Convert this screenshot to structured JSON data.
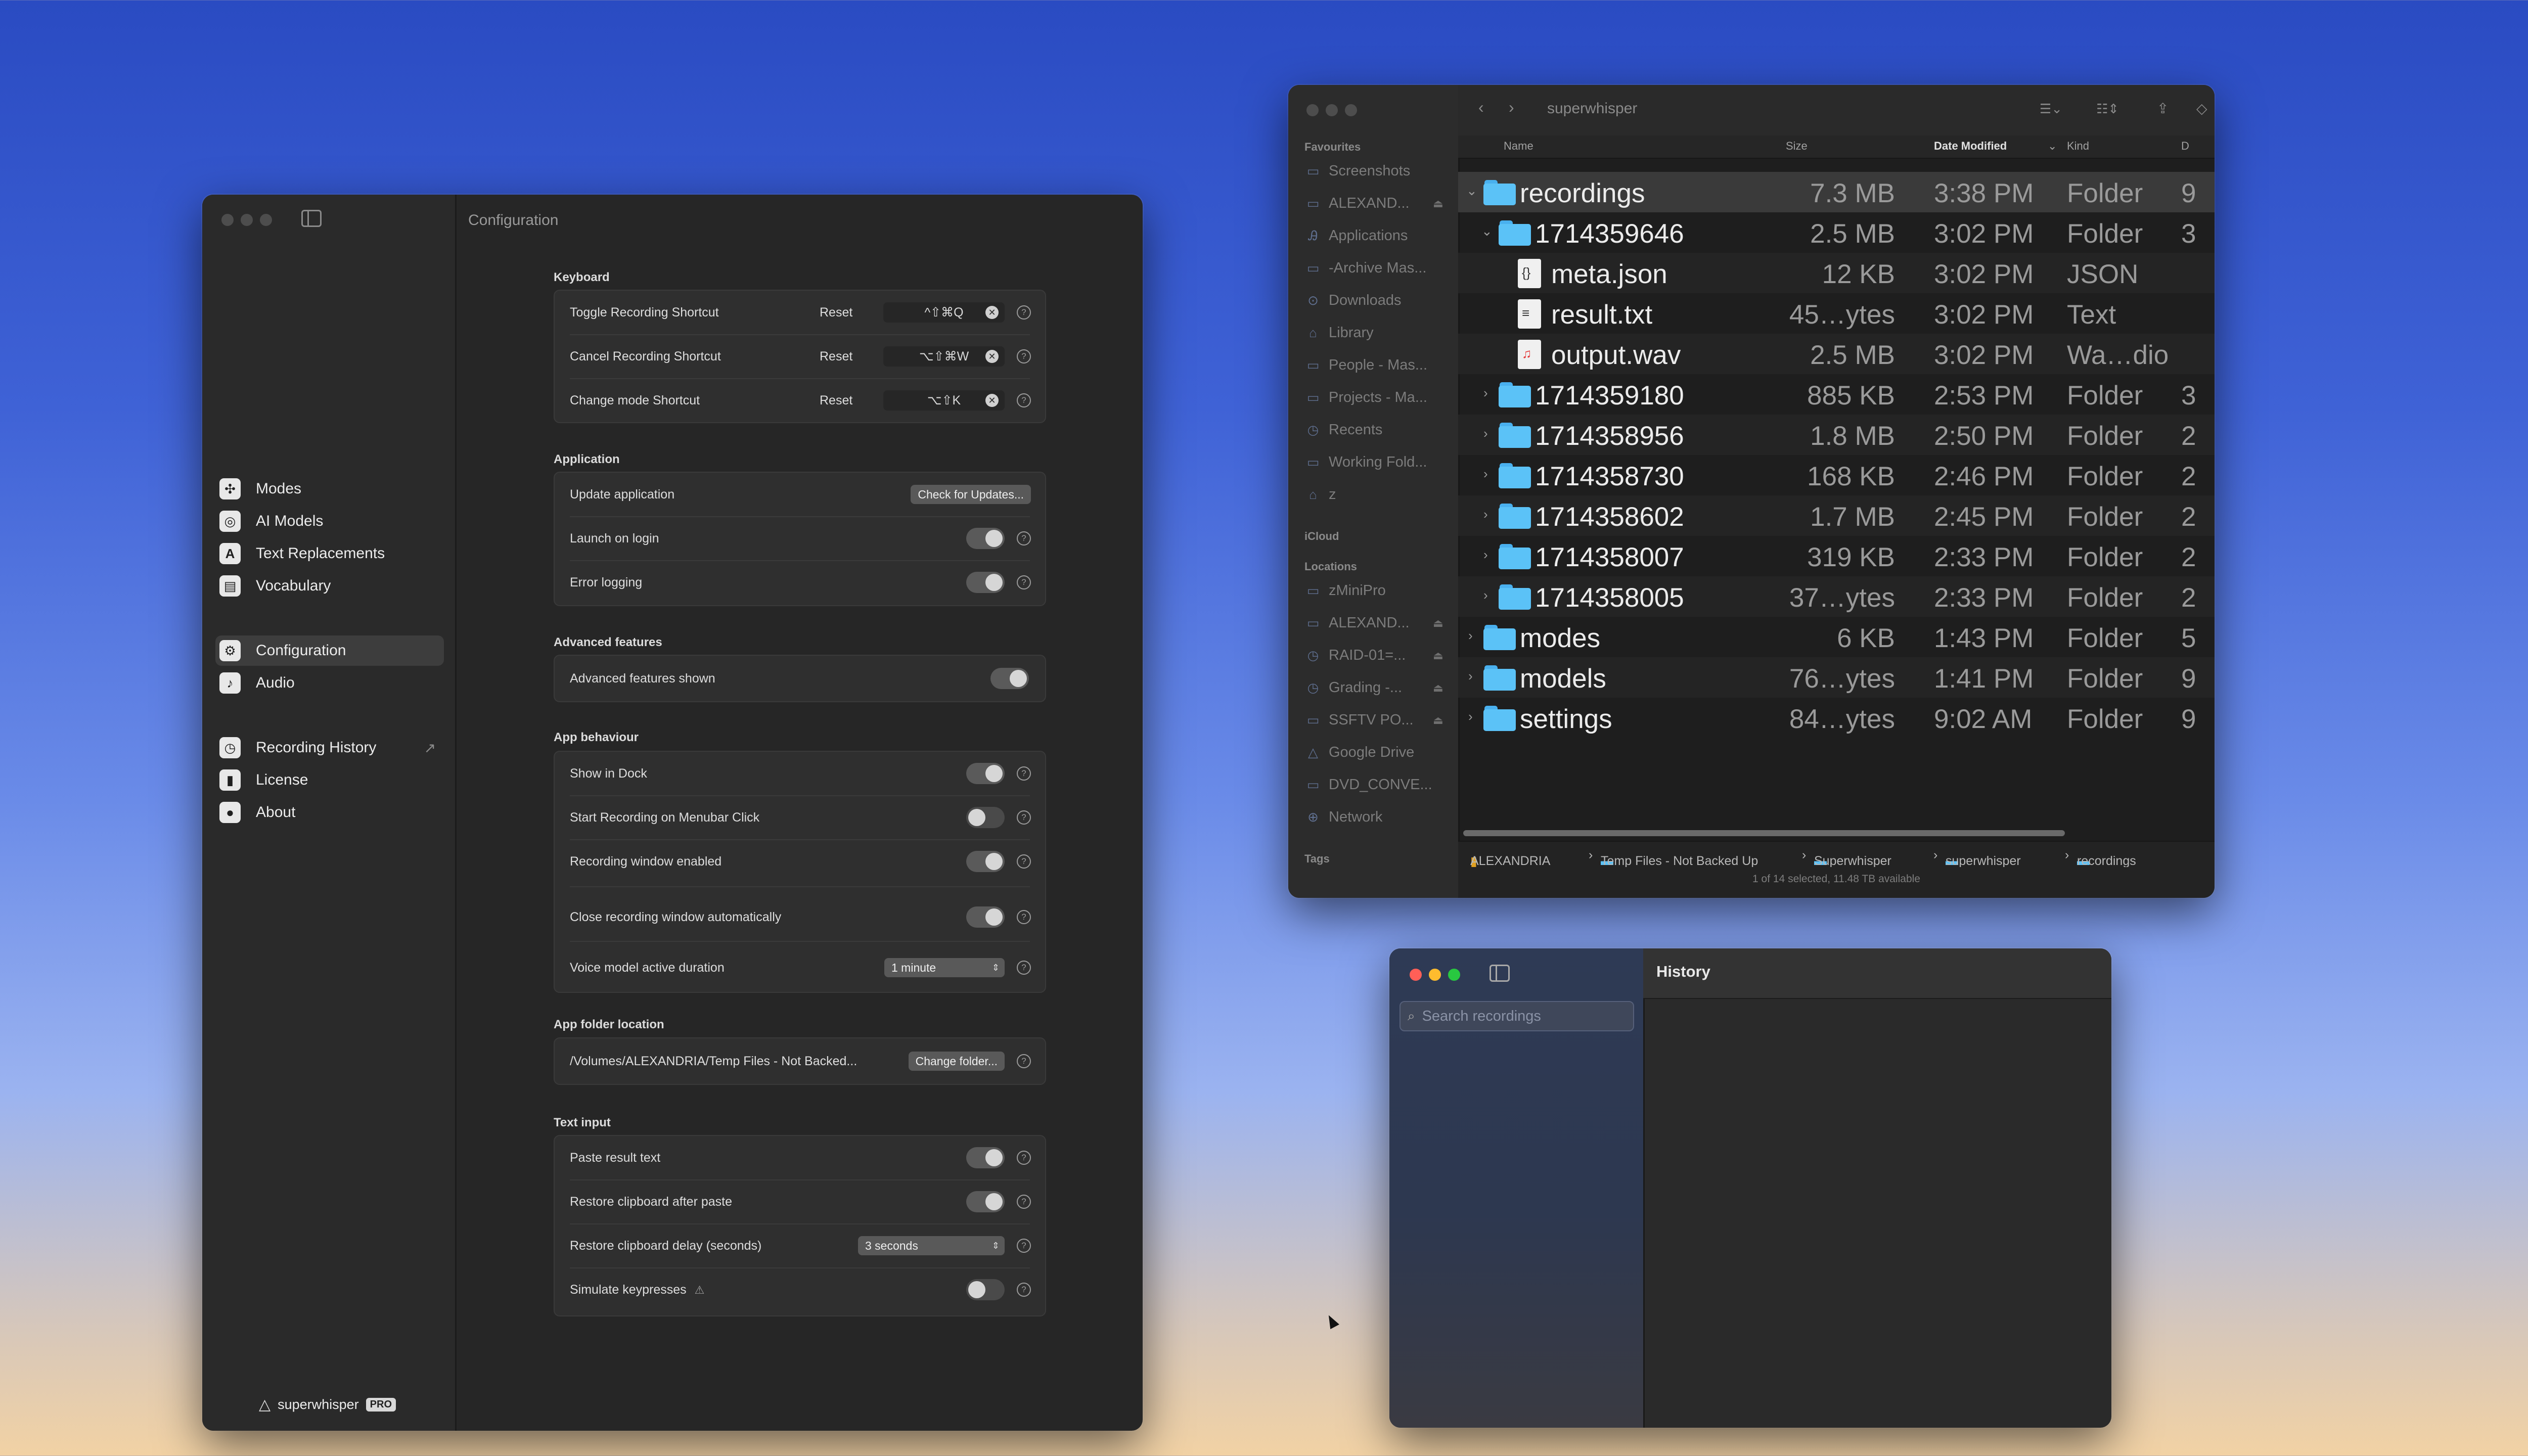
{
  "settings_window": {
    "title": "Configuration",
    "sidebar": {
      "items": [
        {
          "label": "Modes",
          "icon": "modes-icon"
        },
        {
          "label": "AI Models",
          "icon": "ai-models-icon"
        },
        {
          "label": "Text Replacements",
          "icon": "text-replacements-icon"
        },
        {
          "label": "Vocabulary",
          "icon": "vocabulary-icon"
        },
        {
          "label": "Configuration",
          "icon": "configuration-icon",
          "active": true
        },
        {
          "label": "Audio",
          "icon": "audio-icon"
        },
        {
          "label": "Recording History",
          "icon": "recording-history-icon"
        },
        {
          "label": "License",
          "icon": "license-icon"
        },
        {
          "label": "About",
          "icon": "about-icon"
        }
      ],
      "brand": "superwhisper",
      "badge": "PRO"
    },
    "keyboard": {
      "heading": "Keyboard",
      "reset_label": "Reset",
      "rows": [
        {
          "label": "Toggle Recording Shortcut",
          "shortcut": "^⇧⌘Q"
        },
        {
          "label": "Cancel Recording Shortcut",
          "shortcut": "⌥⇧⌘W"
        },
        {
          "label": "Change mode Shortcut",
          "shortcut": "⌥⇧K"
        }
      ]
    },
    "application": {
      "heading": "Application",
      "update_label": "Update application",
      "update_button": "Check for Updates...",
      "launch_label": "Launch on login",
      "error_label": "Error logging"
    },
    "advanced": {
      "heading": "Advanced features",
      "shown_label": "Advanced features shown"
    },
    "behaviour": {
      "heading": "App behaviour",
      "dock_label": "Show in Dock",
      "menubar_label": "Start Recording on Menubar Click",
      "window_label": "Recording window enabled",
      "close_label": "Close recording window automatically",
      "duration_label": "Voice model active duration",
      "duration_value": "1 minute"
    },
    "folder": {
      "heading": "App folder location",
      "path": "/Volumes/ALEXANDRIA/Temp Files - Not Backed...",
      "button": "Change folder..."
    },
    "text_input": {
      "heading": "Text input",
      "paste_label": "Paste result text",
      "restore_label": "Restore clipboard after paste",
      "delay_label": "Restore clipboard delay (seconds)",
      "delay_value": "3 seconds",
      "simulate_label": "Simulate keypresses"
    }
  },
  "finder": {
    "title": "superwhisper",
    "sidebar": {
      "favourites_heading": "Favourites",
      "favourites": [
        "Screenshots",
        "ALEXAND...",
        "Applications",
        "-Archive Mas...",
        "Downloads",
        "Library",
        "People - Mas...",
        "Projects - Ma...",
        "Recents",
        "Working Fold...",
        "z"
      ],
      "icloud_heading": "iCloud",
      "locations_heading": "Locations",
      "locations": [
        "zMiniPro",
        "ALEXAND...",
        "RAID-01=...",
        "Grading -...",
        "SSFTV PO...",
        "Google Drive",
        "DVD_CONVE...",
        "Network"
      ],
      "tags_heading": "Tags"
    },
    "columns": {
      "name": "Name",
      "size": "Size",
      "date": "Date Modified",
      "kind": "Kind",
      "extra": "D"
    },
    "rows": [
      {
        "name": "recordings",
        "size": "7.3 MB",
        "date": "3:38 PM",
        "kind": "Folder",
        "extra": "9"
      },
      {
        "name": "1714359646",
        "size": "2.5 MB",
        "date": "3:02 PM",
        "kind": "Folder",
        "extra": "3"
      },
      {
        "name": "meta.json",
        "size": "12 KB",
        "date": "3:02 PM",
        "kind": "JSON",
        "extra": ""
      },
      {
        "name": "result.txt",
        "size": "45…ytes",
        "date": "3:02 PM",
        "kind": "Text",
        "extra": ""
      },
      {
        "name": "output.wav",
        "size": "2.5 MB",
        "date": "3:02 PM",
        "kind": "Wa…dio",
        "extra": ""
      },
      {
        "name": "1714359180",
        "size": "885 KB",
        "date": "2:53 PM",
        "kind": "Folder",
        "extra": "3"
      },
      {
        "name": "1714358956",
        "size": "1.8 MB",
        "date": "2:50 PM",
        "kind": "Folder",
        "extra": "2"
      },
      {
        "name": "1714358730",
        "size": "168 KB",
        "date": "2:46 PM",
        "kind": "Folder",
        "extra": "2"
      },
      {
        "name": "1714358602",
        "size": "1.7 MB",
        "date": "2:45 PM",
        "kind": "Folder",
        "extra": "2"
      },
      {
        "name": "1714358007",
        "size": "319 KB",
        "date": "2:33 PM",
        "kind": "Folder",
        "extra": "2"
      },
      {
        "name": "1714358005",
        "size": "37…ytes",
        "date": "2:33 PM",
        "kind": "Folder",
        "extra": "2"
      },
      {
        "name": "modes",
        "size": "6 KB",
        "date": "1:43 PM",
        "kind": "Folder",
        "extra": "5"
      },
      {
        "name": "models",
        "size": "76…ytes",
        "date": "1:41 PM",
        "kind": "Folder",
        "extra": "9"
      },
      {
        "name": "settings",
        "size": "84…ytes",
        "date": "9:02 AM",
        "kind": "Folder",
        "extra": "9"
      }
    ],
    "path": [
      "ALEXANDRIA",
      "Temp Files - Not Backed Up",
      "Superwhisper",
      "superwhisper",
      "recordings"
    ],
    "status": "1 of 14 selected, 11.48 TB available"
  },
  "history_window": {
    "title": "History",
    "search_placeholder": "Search recordings"
  }
}
